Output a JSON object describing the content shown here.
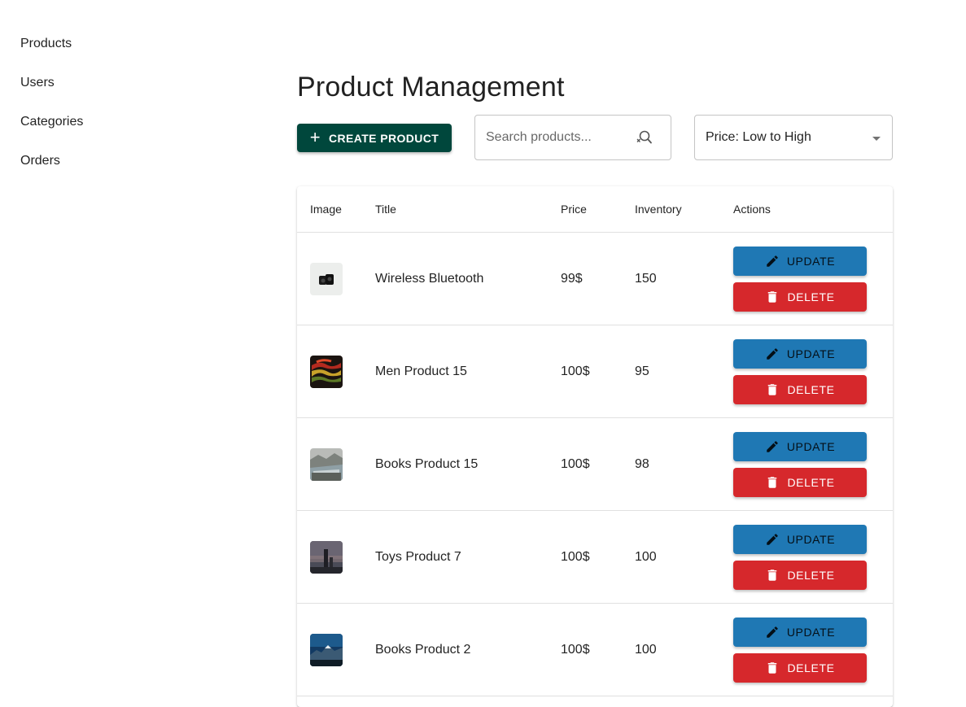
{
  "sidebar": {
    "items": [
      {
        "label": "Products"
      },
      {
        "label": "Users"
      },
      {
        "label": "Categories"
      },
      {
        "label": "Orders"
      }
    ]
  },
  "main": {
    "title": "Product Management",
    "create_label": "CREATE PRODUCT",
    "search_placeholder": "Search products...",
    "sort_value": "Price: Low to High"
  },
  "table": {
    "headers": {
      "image": "Image",
      "title": "Title",
      "price": "Price",
      "inventory": "Inventory",
      "actions": "Actions"
    },
    "rows": [
      {
        "title": "Wireless Bluetooth",
        "price": "99$",
        "inventory": "150"
      },
      {
        "title": "Men Product 15",
        "price": "100$",
        "inventory": "95"
      },
      {
        "title": "Books Product 15",
        "price": "100$",
        "inventory": "98"
      },
      {
        "title": "Toys Product 7",
        "price": "100$",
        "inventory": "100"
      },
      {
        "title": "Books Product 2",
        "price": "100$",
        "inventory": "100"
      }
    ],
    "update_label": "UPDATE",
    "delete_label": "DELETE"
  },
  "colors": {
    "create_button": "#00473c",
    "update_button": "#1f78b4",
    "delete_button": "#d6282c"
  },
  "icons": [
    "plus-icon",
    "search-icon",
    "dropdown-caret-icon",
    "pencil-icon",
    "trash-icon"
  ]
}
